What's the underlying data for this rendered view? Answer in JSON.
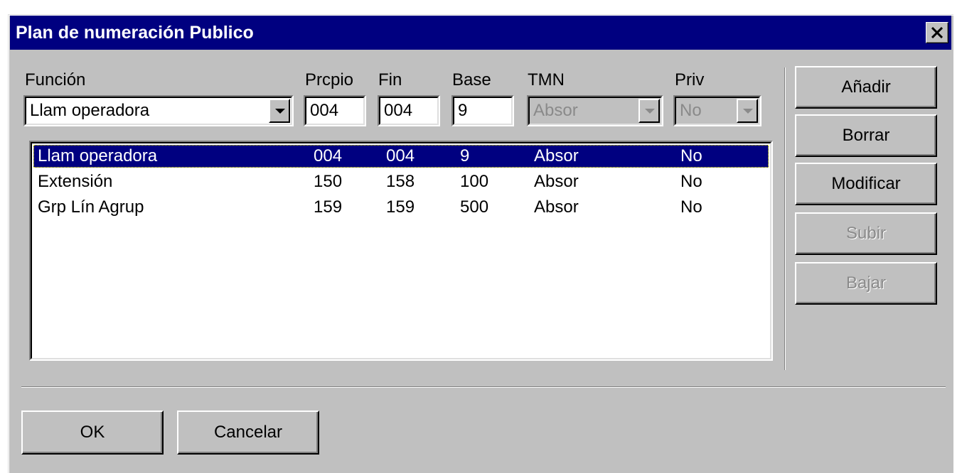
{
  "window": {
    "title": "Plan de numeración Publico"
  },
  "form": {
    "labels": {
      "funcion": "Función",
      "prcpio": "Prcpio",
      "fin": "Fin",
      "base": "Base",
      "tmn": "TMN",
      "priv": "Priv"
    },
    "funcion_value": "Llam operadora",
    "prcpio_value": "004",
    "fin_value": "004",
    "base_value": "9",
    "tmn_value": "Absor",
    "priv_value": "No"
  },
  "list": {
    "rows": [
      {
        "funcion": "Llam operadora",
        "prcpio": "004",
        "fin": "004",
        "base": "9",
        "tmn": "Absor",
        "priv": "No",
        "selected": true
      },
      {
        "funcion": "Extensión",
        "prcpio": "150",
        "fin": "158",
        "base": "100",
        "tmn": "Absor",
        "priv": "No",
        "selected": false
      },
      {
        "funcion": "Grp Lín Agrup",
        "prcpio": "159",
        "fin": "159",
        "base": "500",
        "tmn": "Absor",
        "priv": "No",
        "selected": false
      }
    ]
  },
  "buttons": {
    "add": "Añadir",
    "delete": "Borrar",
    "modify": "Modificar",
    "up": "Subir",
    "down": "Bajar",
    "ok": "OK",
    "cancel": "Cancelar"
  },
  "colors": {
    "titlebar": "#000080",
    "face": "#c0c0c0",
    "selection": "#000080"
  }
}
